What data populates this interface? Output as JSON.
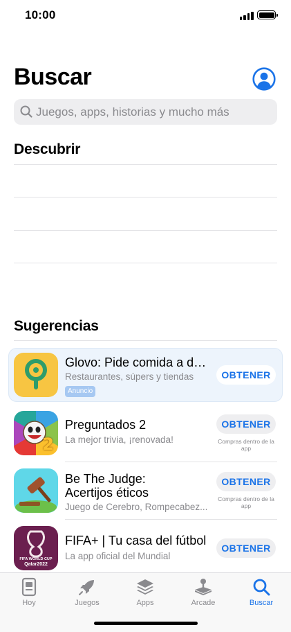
{
  "status_bar": {
    "time": "10:00"
  },
  "header": {
    "title": "Buscar",
    "account_icon": "person-circle-icon"
  },
  "search": {
    "placeholder": "Juegos, apps, historias y mucho más"
  },
  "discover": {
    "title": "Descubrir",
    "items": [
      "",
      "",
      "",
      ""
    ]
  },
  "suggestions": {
    "title": "Sugerencias",
    "apps": [
      {
        "name": "Glovo: Pide comida a do...",
        "subtitle": "Restaurantes, súpers y tiendas",
        "badge": "Anuncio",
        "button": "OBTENER",
        "note": ""
      },
      {
        "name": "Preguntados 2",
        "subtitle": "La mejor trivia, ¡renovada!",
        "button": "OBTENER",
        "note": "Compras dentro de la app"
      },
      {
        "name_line1": "Be The Judge:",
        "name_line2": "Acertijos éticos",
        "subtitle": "Juego de Cerebro, Rompecabez...",
        "button": "OBTENER",
        "note": "Compras dentro de la app"
      },
      {
        "name": "FIFA+ | Tu casa del fútbol",
        "subtitle": "La app oficial del Mundial",
        "button": "OBTENER",
        "note": ""
      }
    ]
  },
  "icon_text": {
    "fifa_line1": "FIFA WORLD CUP",
    "fifa_line2": "Qatar2022",
    "preguntados_number": "2"
  },
  "tabs": [
    {
      "label": "Hoy",
      "icon": "today-icon",
      "active": false
    },
    {
      "label": "Juegos",
      "icon": "rocket-icon",
      "active": false
    },
    {
      "label": "Apps",
      "icon": "stack-icon",
      "active": false
    },
    {
      "label": "Arcade",
      "icon": "joystick-icon",
      "active": false
    },
    {
      "label": "Buscar",
      "icon": "search-icon",
      "active": true
    }
  ],
  "colors": {
    "accent": "#1a73e8",
    "ad_background": "#edf4fc",
    "glovo_yellow": "#f7c542",
    "glovo_green": "#2e9c6b",
    "fifa_purple": "#6b1f4f",
    "judge_cyan": "#5fd7e8"
  }
}
